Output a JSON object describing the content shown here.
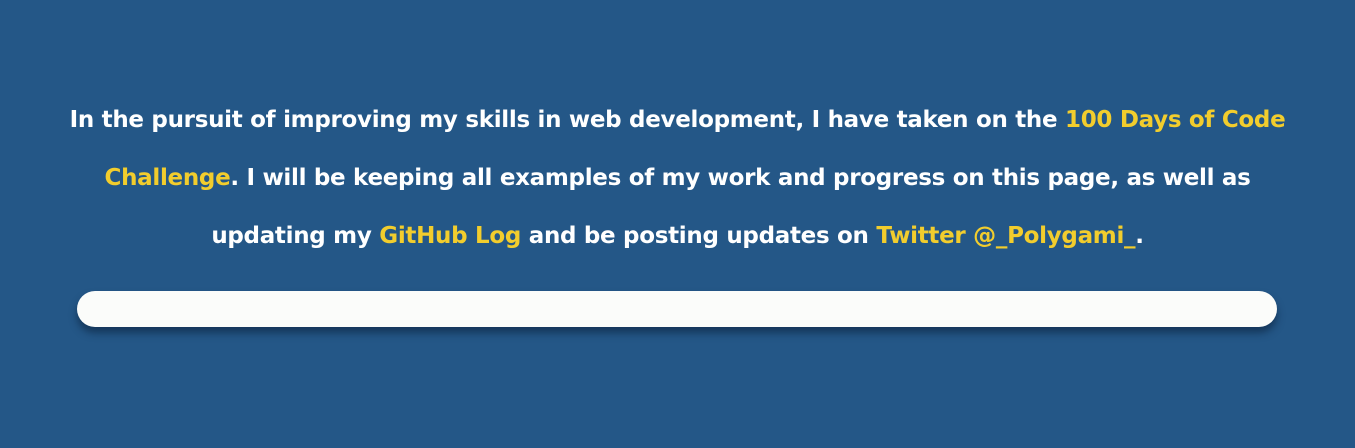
{
  "intro": {
    "text_1": "In the pursuit of improving my skills in web development, I have taken on the ",
    "link_challenge": "100 Days of Code Challenge",
    "text_2": ". I will be keeping all examples of my work and progress on this page, as well as updating my ",
    "link_github": "GitHub Log",
    "text_3": " and be posting updates on ",
    "link_twitter": "Twitter @_Polygami_",
    "text_4": "."
  },
  "progress": {
    "fraction": 0
  },
  "colors": {
    "background": "#245787",
    "text": "#ffffff",
    "link": "#f2cd2d",
    "bar_track": "#fbfcfa"
  }
}
